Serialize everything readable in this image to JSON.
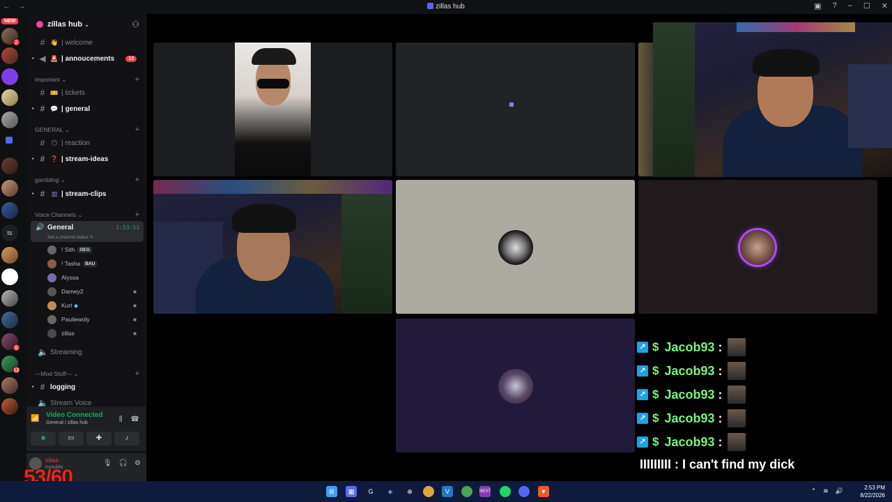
{
  "window": {
    "title": "zillas hub"
  },
  "rail": {
    "new_label": "NEW",
    "badges": [
      "2",
      "6",
      "13"
    ],
    "server_text": "ts"
  },
  "guild": {
    "name": "zillas hub"
  },
  "channels": {
    "welcome": "| welcome",
    "annoucements": "| annoucements",
    "annoucements_count": "13",
    "cat_important": "Important",
    "tickets": "| tickets",
    "general": "| general",
    "cat_general": "GENERAL",
    "reaction": "| reaction",
    "stream_ideas": "| stream-ideas",
    "cat_gambling": "gambling",
    "stream_clips": "| stream-clips",
    "cat_voice": "Voice Channels",
    "voice_general": "General",
    "voice_timer": "1:53:53",
    "voice_status": "Set a channel status",
    "streaming": "Streaming",
    "cat_mod": "---Mod Stuff---",
    "logging": "logging",
    "stream_voice": "Stream Voice"
  },
  "members": [
    {
      "name": "! Sith",
      "tag": "OEG"
    },
    {
      "name": "! Tasha",
      "tag": "BAU"
    },
    {
      "name": "Alyssa"
    },
    {
      "name": "Damey2"
    },
    {
      "name": "Kurt"
    },
    {
      "name": "Pauliewoly"
    },
    {
      "name": "zillas"
    }
  ],
  "voice_panel": {
    "status": "Video Connected",
    "location": "General / zillas hub"
  },
  "user_panel": {
    "name": "zillas",
    "status": "Invisible"
  },
  "counter": "53/60",
  "chat_overlay": {
    "lines": [
      "Jacob93",
      "Jacob93",
      "Jacob93",
      "Jacob93",
      "Jacob93"
    ],
    "dollar": "$",
    "colon": ":",
    "message": "IIIIIIIII : I can't find my dick"
  },
  "taskbar": {
    "time": "2:53 PM",
    "date": "8/22/2026"
  },
  "colors": {
    "accent": "#5865f2",
    "online": "#23a559",
    "alert": "#f23f43",
    "chat_name": "#7bf27b"
  }
}
